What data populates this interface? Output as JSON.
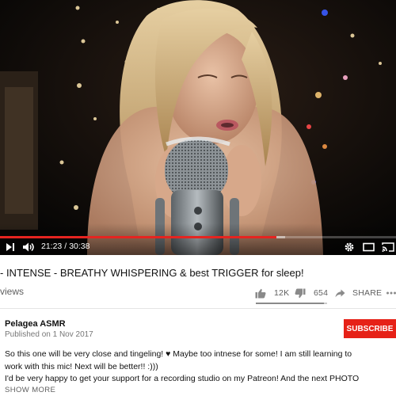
{
  "player": {
    "current_time": "21:23",
    "separator": "/",
    "duration": "30:38",
    "progress_fraction": 0.698,
    "accent_color": "#e52420"
  },
  "video": {
    "title": "- INTENSE - BREATHY WHISPERING & best TRIGGER for sleep!",
    "views": "views"
  },
  "actions": {
    "likes": "12K",
    "dislikes": "654",
    "share_label": "SHARE",
    "like_fraction": 0.95
  },
  "channel": {
    "name": "Pelagea ASMR",
    "published": "Published on 1 Nov 2017",
    "subscribe_label": "SUBSCRIBE",
    "subscribe_color": "#e62117"
  },
  "description": {
    "lines": [
      "So this one will be very close and tingeling! ♥ Maybe too intnese for some! I am still learning to",
      "work with this mic! Next will be better!! :)))",
      "I'd be very happy to get your support for a recording studio on my Patreon! And the next PHOTO"
    ],
    "show_more_label": "SHOW MORE"
  },
  "icons": {
    "play_next": "skip-next-icon",
    "volume": "volume-icon",
    "settings": "gear-icon",
    "theater": "theater-mode-icon",
    "cast": "cast-icon",
    "like": "thumb-up-icon",
    "dislike": "thumb-down-icon",
    "share": "share-arrow-icon",
    "more": "more-icon"
  }
}
